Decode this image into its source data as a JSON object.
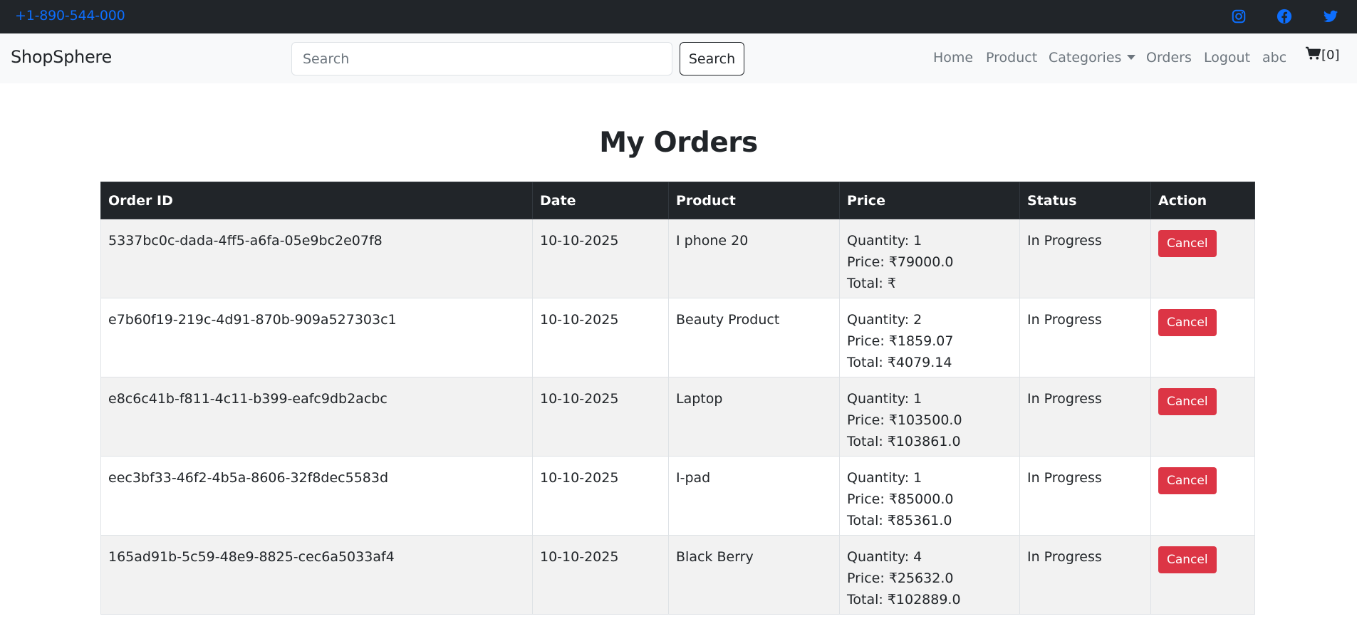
{
  "topbar": {
    "phone": "+1-890-544-000",
    "icons": [
      "instagram-icon",
      "facebook-icon",
      "twitter-icon"
    ],
    "icon_color": "#0d6efd"
  },
  "navbar": {
    "brand": "ShopSphere",
    "search_placeholder": "Search",
    "search_value": "",
    "search_button": "Search",
    "links": {
      "home": "Home",
      "product": "Product",
      "categories": "Categories",
      "orders": "Orders",
      "logout": "Logout",
      "user": "abc"
    },
    "cart_count": "[0]"
  },
  "page": {
    "title": "My Orders"
  },
  "table": {
    "headers": {
      "order_id": "Order ID",
      "date": "Date",
      "product": "Product",
      "price": "Price",
      "status": "Status",
      "action": "Action"
    },
    "rows": [
      {
        "order_id": "5337bc0c-dada-4ff5-a6fa-05e9bc2e07f8",
        "date": "10-10-2025",
        "product": "I phone 20",
        "quantity": "Quantity: 1",
        "price": "Price: ₹79000.0",
        "total": "Total: ₹",
        "status": "In Progress",
        "action": "Cancel"
      },
      {
        "order_id": "e7b60f19-219c-4d91-870b-909a527303c1",
        "date": "10-10-2025",
        "product": "Beauty Product",
        "quantity": "Quantity: 2",
        "price": "Price: ₹1859.07",
        "total": "Total: ₹4079.14",
        "status": "In Progress",
        "action": "Cancel"
      },
      {
        "order_id": "e8c6c41b-f811-4c11-b399-eafc9db2acbc",
        "date": "10-10-2025",
        "product": "Laptop",
        "quantity": "Quantity: 1",
        "price": "Price: ₹103500.0",
        "total": "Total: ₹103861.0",
        "status": "In Progress",
        "action": "Cancel"
      },
      {
        "order_id": "eec3bf33-46f2-4b5a-8606-32f8dec5583d",
        "date": "10-10-2025",
        "product": "I-pad",
        "quantity": "Quantity: 1",
        "price": "Price: ₹85000.0",
        "total": "Total: ₹85361.0",
        "status": "In Progress",
        "action": "Cancel"
      },
      {
        "order_id": "165ad91b-5c59-48e9-8825-cec6a5033af4",
        "date": "10-10-2025",
        "product": "Black Berry",
        "quantity": "Quantity: 4",
        "price": "Price: ₹25632.0",
        "total": "Total: ₹102889.0",
        "status": "In Progress",
        "action": "Cancel"
      }
    ]
  },
  "colors": {
    "dark": "#212529",
    "link_blue": "#0d6efd",
    "danger": "#dc3545",
    "muted": "#6c757d"
  }
}
